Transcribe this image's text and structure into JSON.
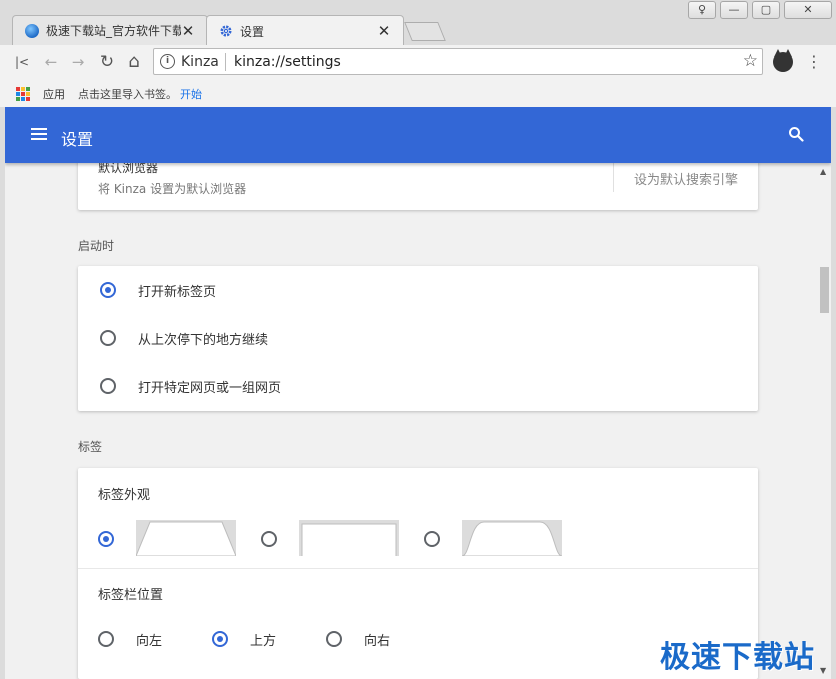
{
  "window": {
    "controls": [
      "♀",
      "—",
      "▢",
      "✕"
    ]
  },
  "tabs": [
    {
      "title": "极速下载站_官方软件下载_",
      "icon": "globe-icon",
      "close": "✕"
    },
    {
      "title": "设置",
      "icon": "gear-icon",
      "close": "✕"
    }
  ],
  "toolbar": {
    "site_label": "Kinza",
    "url": "kinza://settings",
    "info": "i",
    "star": "☆",
    "menu": "⋮",
    "first": "|<",
    "back": "←",
    "forward": "→",
    "reload": "↻",
    "home": "⌂"
  },
  "bookmarks": {
    "apps": "应用",
    "import": "点击这里导入书签。",
    "start": "开始"
  },
  "header": {
    "title": "设置"
  },
  "default_browser": {
    "title": "默认浏览器",
    "subtitle": "将 Kinza 设置为默认浏览器",
    "button": "设为默认搜索引擎"
  },
  "startup": {
    "label": "启动时",
    "options": [
      {
        "label": "打开新标签页",
        "checked": true
      },
      {
        "label": "从上次停下的地方继续",
        "checked": false
      },
      {
        "label": "打开特定网页或一组网页",
        "checked": false
      }
    ]
  },
  "tabs_section": {
    "label": "标签",
    "appearance_label": "标签外观",
    "appearance_selected": 0,
    "position_label": "标签栏位置",
    "position_options": [
      {
        "label": "向左",
        "checked": false
      },
      {
        "label": "上方",
        "checked": true
      },
      {
        "label": "向右",
        "checked": false
      }
    ]
  },
  "scrollbar": {
    "up": "▲",
    "down": "▼"
  },
  "watermark": "极速下载站",
  "colors": {
    "accent": "#3367d6",
    "link": "#1a73e8"
  }
}
